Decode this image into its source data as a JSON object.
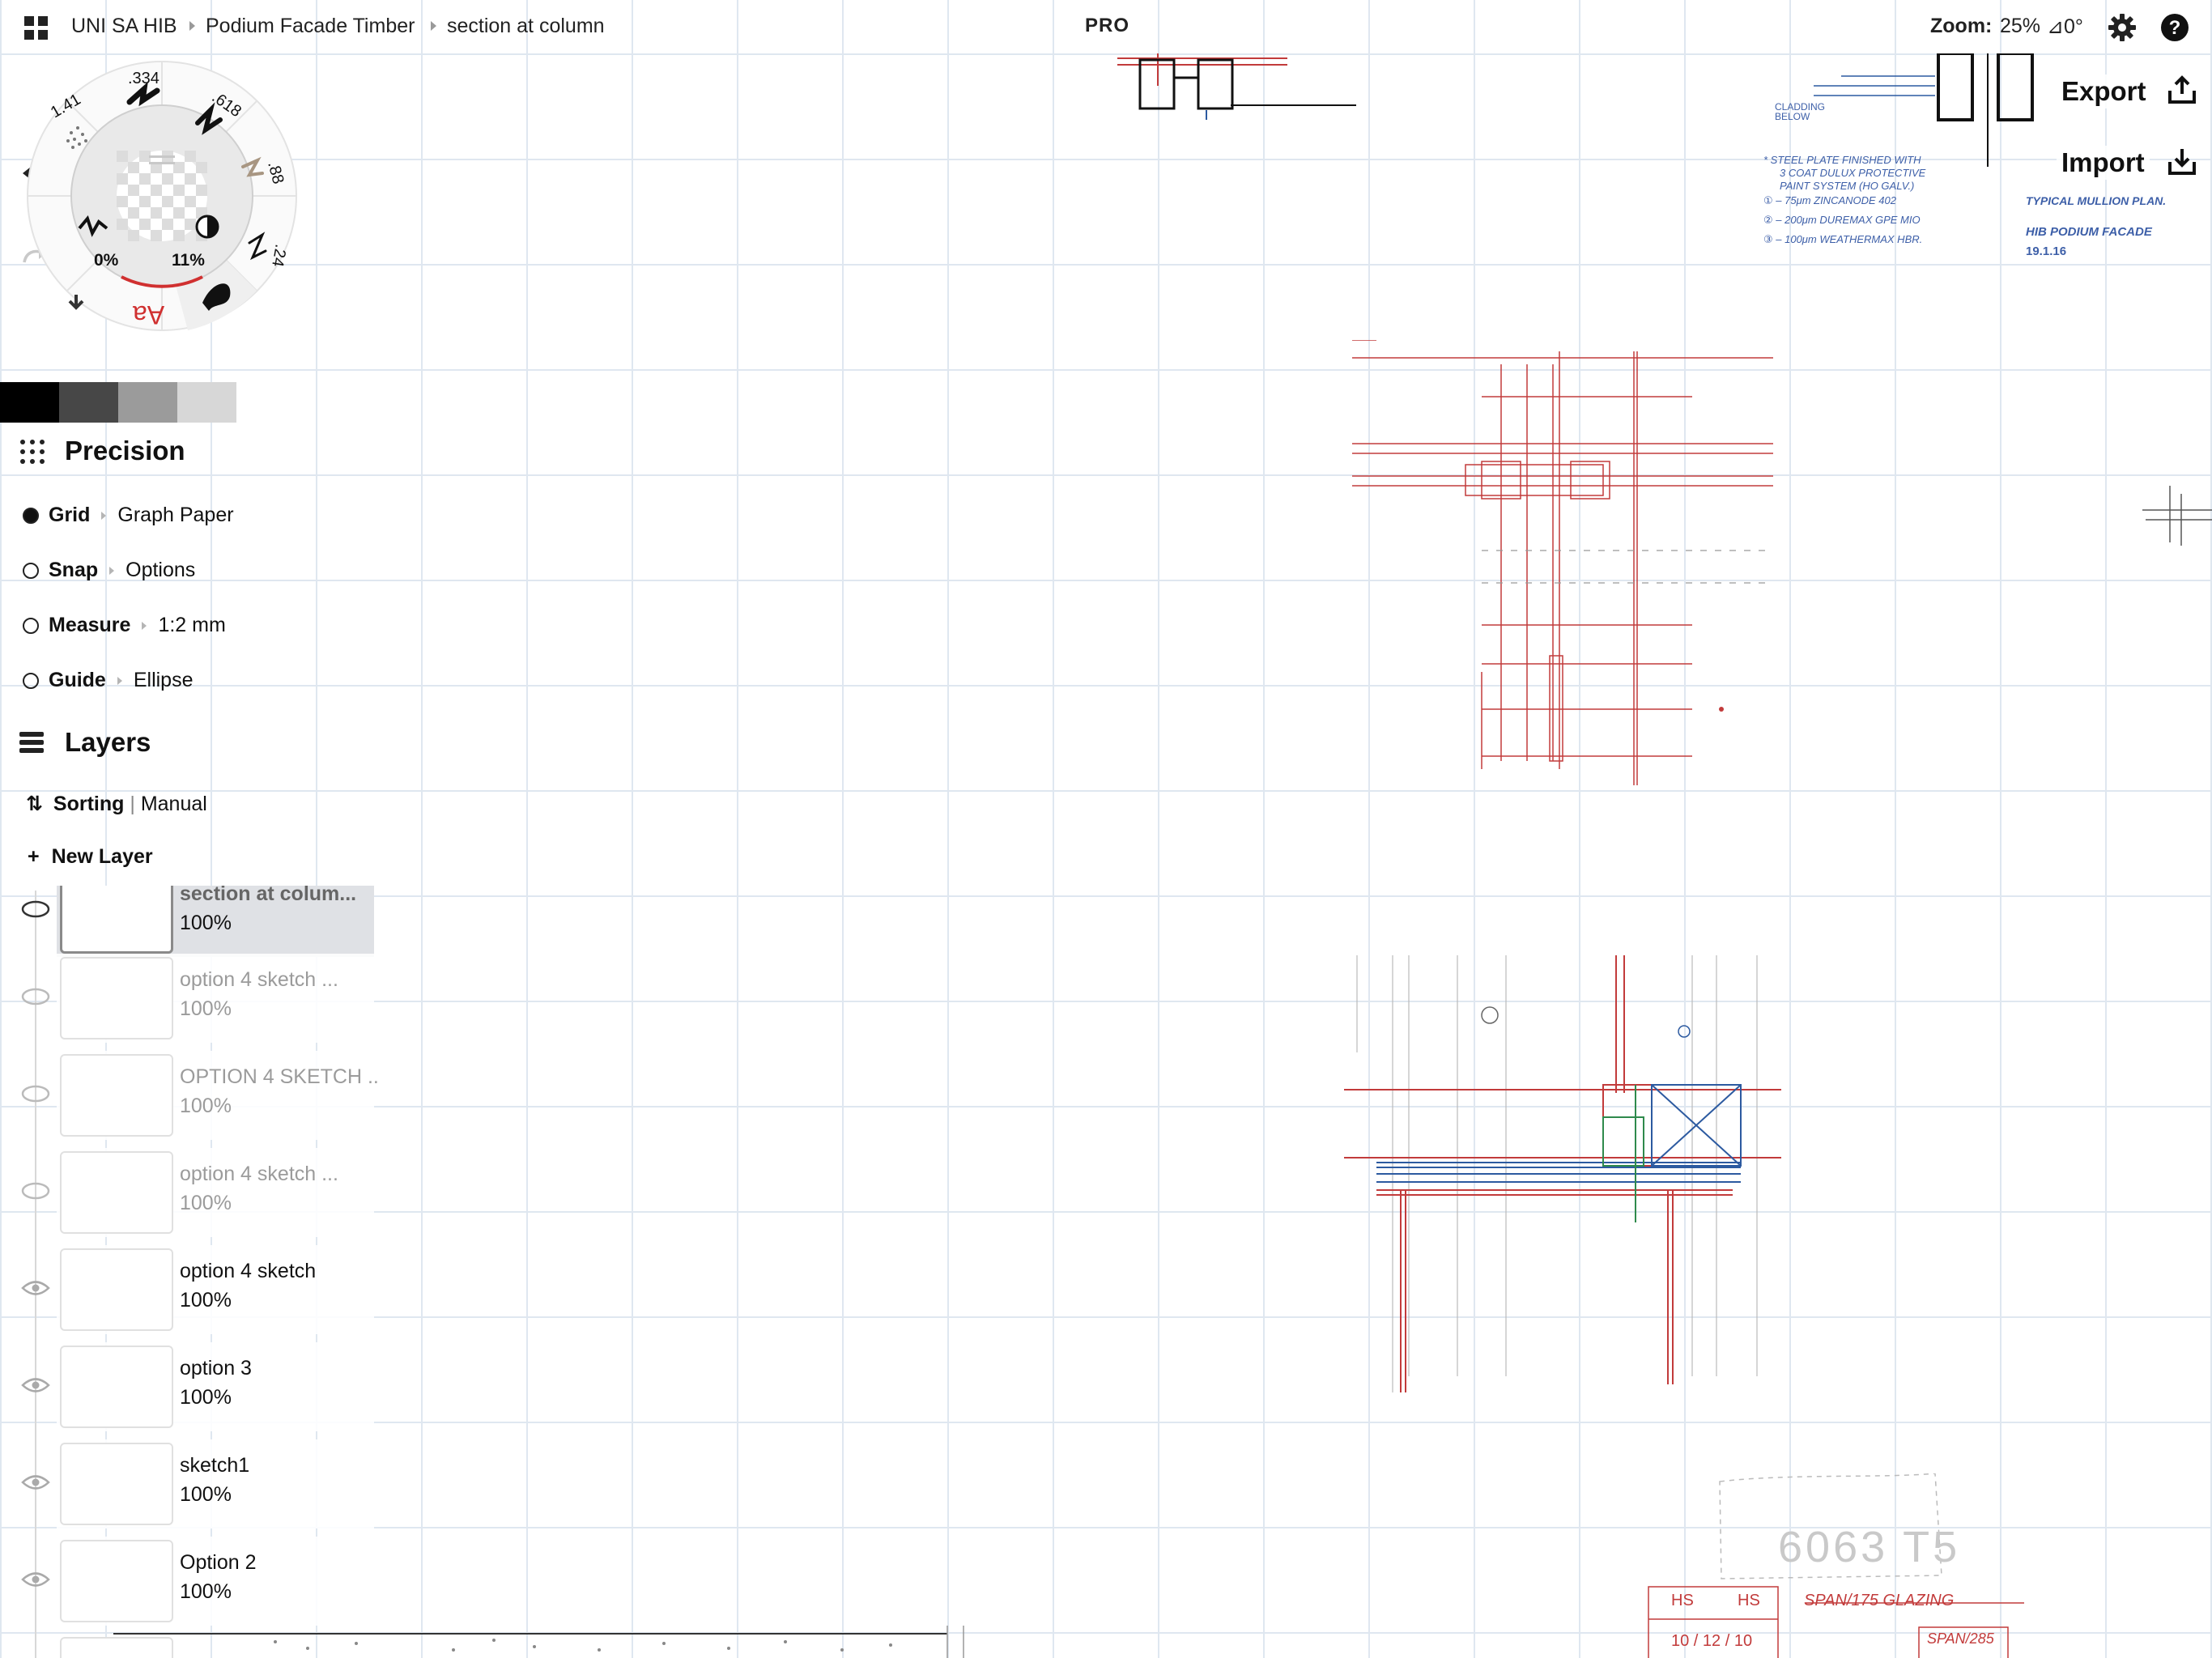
{
  "topbar": {
    "breadcrumb": [
      "UNI SA HIB",
      "Podium Facade Timber",
      "section at column"
    ],
    "pro_label": "PRO",
    "zoom_label": "Zoom:",
    "zoom_value": "25%",
    "rotation_value": "⊿0°",
    "icons": [
      "grid-menu-icon",
      "gear-icon",
      "help-icon"
    ]
  },
  "actions": {
    "export_label": "Export",
    "import_label": "Import"
  },
  "wheel": {
    "smoothing": "1.41",
    "weight_a": ".334",
    "weight_b": ".618",
    "weight_c": ".88",
    "weight_d": ".24",
    "opacity_value": "0%",
    "blend_value": "11%",
    "text_tool": "Aa"
  },
  "swatches": [
    "#000000",
    "#474747",
    "#9b9b9b",
    "#d7d7d7"
  ],
  "precision": {
    "title": "Precision",
    "rows": [
      {
        "name": "Grid",
        "value": "Graph Paper",
        "on": true
      },
      {
        "name": "Snap",
        "value": "Options",
        "on": false
      },
      {
        "name": "Measure",
        "value": "1:2 mm",
        "on": false
      },
      {
        "name": "Guide",
        "value": "Ellipse",
        "on": false
      }
    ]
  },
  "layers": {
    "title": "Layers",
    "sorting_label": "Sorting",
    "sorting_value": "Manual",
    "new_layer_label": "New Layer",
    "items": [
      {
        "name": "section at colum...",
        "opacity": "100%",
        "visible": true,
        "active": true
      },
      {
        "name": "option 4 sketch ...",
        "opacity": "100%",
        "visible": false
      },
      {
        "name": "OPTION 4 SKETCH ...",
        "opacity": "100%",
        "visible": false
      },
      {
        "name": "option 4 sketch ...",
        "opacity": "100%",
        "visible": false
      },
      {
        "name": "option 4 sketch",
        "opacity": "100%",
        "visible": true
      },
      {
        "name": "option 3",
        "opacity": "100%",
        "visible": true
      },
      {
        "name": "sketch1",
        "opacity": "100%",
        "visible": true
      },
      {
        "name": "Option 2",
        "opacity": "100%",
        "visible": true
      }
    ]
  },
  "canvas": {
    "notes": [
      "* STEEL PLATE FINISHED WITH",
      "3 COAT DULUX PROTECTIVE",
      "PAINT SYSTEM (HO GALV.)",
      "① – 75μm ZINCANODE 402",
      "② – 200μm DUREMAX GPE MIO",
      "③ – 100μm WEATHERMAX HBR."
    ],
    "label_cladding": "CLADDING BELOW",
    "label_typical": "TYPICAL MULLION PLAN.",
    "label_facade": "HIB PODIUM FACADE",
    "label_date": "19.1.16",
    "label_size": "6063 T5",
    "label_span1": "SPAN/175 GLAZING",
    "label_span2": "SPAN/285",
    "label_hs1": "HS",
    "label_hs2": "HS",
    "label_dims": "10 / 12 / 10"
  },
  "colors": {
    "sketch_red": "#c23b3b",
    "sketch_blue": "#2c5aa0",
    "sketch_green": "#2f8a4c",
    "ink_blue": "#3d5fa8"
  }
}
